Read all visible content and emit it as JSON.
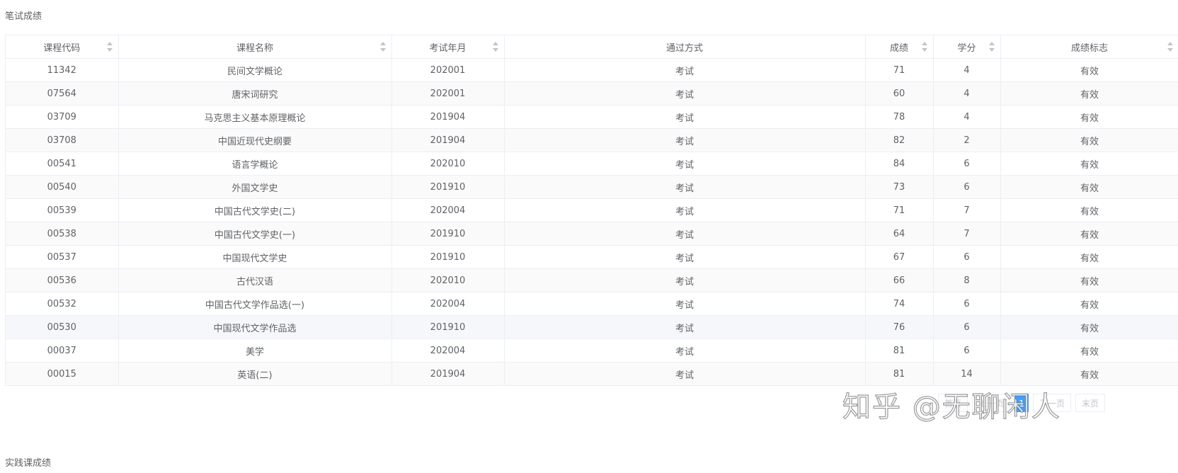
{
  "sections": {
    "written_title": "笔试成绩",
    "practice_title": "实践课成绩"
  },
  "table": {
    "headers": [
      "课程代码",
      "课程名称",
      "考试年月",
      "通过方式",
      "成绩",
      "学分",
      "成绩标志"
    ],
    "rows": [
      [
        "11342",
        "民间文学概论",
        "202001",
        "考试",
        "71",
        "4",
        "有效"
      ],
      [
        "07564",
        "唐宋词研究",
        "202001",
        "考试",
        "60",
        "4",
        "有效"
      ],
      [
        "03709",
        "马克思主义基本原理概论",
        "201904",
        "考试",
        "78",
        "4",
        "有效"
      ],
      [
        "03708",
        "中国近现代史纲要",
        "201904",
        "考试",
        "82",
        "2",
        "有效"
      ],
      [
        "00541",
        "语言学概论",
        "202010",
        "考试",
        "84",
        "6",
        "有效"
      ],
      [
        "00540",
        "外国文学史",
        "201910",
        "考试",
        "73",
        "6",
        "有效"
      ],
      [
        "00539",
        "中国古代文学史(二)",
        "202004",
        "考试",
        "71",
        "7",
        "有效"
      ],
      [
        "00538",
        "中国古代文学史(一)",
        "201910",
        "考试",
        "64",
        "7",
        "有效"
      ],
      [
        "00537",
        "中国现代文学史",
        "201910",
        "考试",
        "67",
        "6",
        "有效"
      ],
      [
        "00536",
        "古代汉语",
        "202010",
        "考试",
        "66",
        "8",
        "有效"
      ],
      [
        "00532",
        "中国古代文学作品选(一)",
        "202004",
        "考试",
        "74",
        "6",
        "有效"
      ],
      [
        "00530",
        "中国现代文学作品选",
        "201910",
        "考试",
        "76",
        "6",
        "有效"
      ],
      [
        "00037",
        "美学",
        "202004",
        "考试",
        "81",
        "6",
        "有效"
      ],
      [
        "00015",
        "英语(二)",
        "201904",
        "考试",
        "81",
        "14",
        "有效"
      ]
    ]
  },
  "pager": {
    "first": "首页",
    "prev": "上一页",
    "current": "1",
    "next": "下一页",
    "last": "末页"
  },
  "watermark": "知乎 @无聊闲人",
  "colors": {
    "border": "#ebeef5",
    "text": "#606266",
    "stripe": "#fafafa",
    "active": "#409eff"
  }
}
